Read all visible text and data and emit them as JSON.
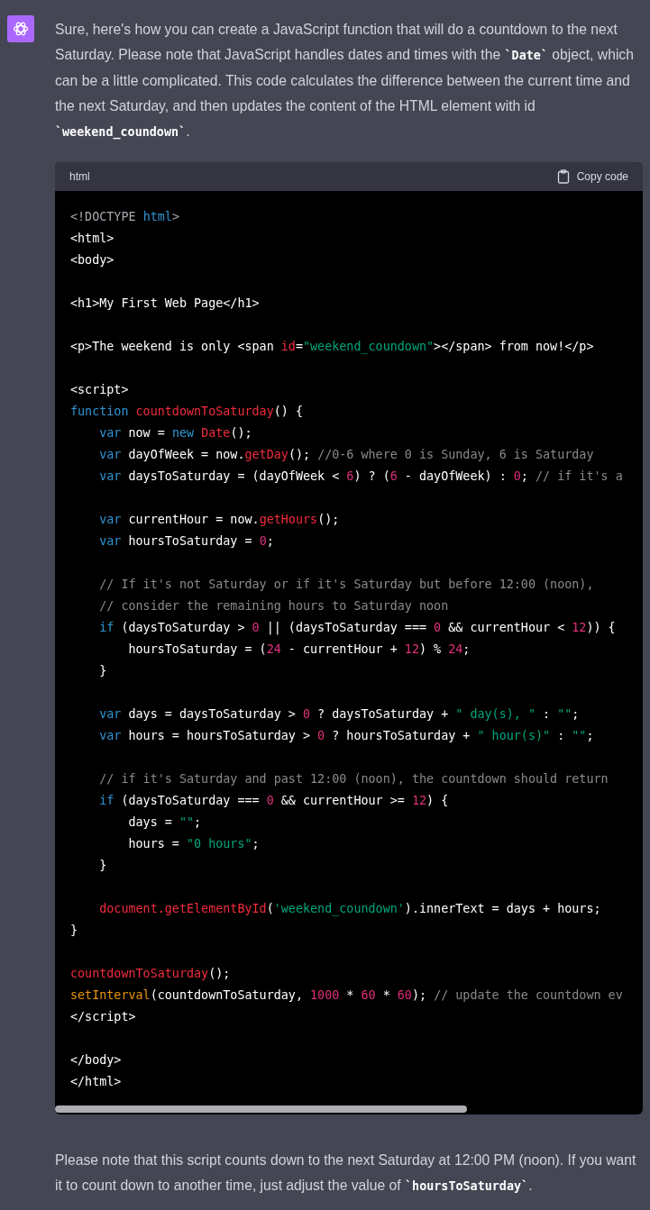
{
  "message": {
    "intro": "Sure, here's how you can create a JavaScript function that will do a countdown to the next Saturday. Please note that JavaScript handles dates and times with the **`Date`** object, which can be a little complicated. This code calculates the difference between the current time and the next Saturday, and then updates the content of the HTML element with id **`weekend_coundown`**.",
    "code_block": {
      "language": "html",
      "copy_label": "Copy code",
      "lines": [
        {
          "kind": "code",
          "tokens": [
            {
              "kind": "meta",
              "text": "<!DOCTYPE "
            },
            {
              "kind": "keyword",
              "text": "html"
            },
            {
              "kind": "meta",
              "text": ">"
            }
          ]
        },
        {
          "kind": "code",
          "tokens": [
            {
              "kind": "plain",
              "text": "<html>"
            }
          ]
        },
        {
          "kind": "code",
          "tokens": [
            {
              "kind": "plain",
              "text": "<body>"
            }
          ]
        },
        {
          "kind": "blank"
        },
        {
          "kind": "code",
          "tokens": [
            {
              "kind": "plain",
              "text": "<h1>My First Web Page</h1>"
            }
          ]
        },
        {
          "kind": "blank"
        },
        {
          "kind": "code",
          "tokens": [
            {
              "kind": "plain",
              "text": "<p>The weekend is only <span "
            },
            {
              "kind": "attr",
              "text": "id"
            },
            {
              "kind": "plain",
              "text": "="
            },
            {
              "kind": "string",
              "text": "\"weekend_coundown\""
            },
            {
              "kind": "plain",
              "text": "></span> from now!</p>"
            }
          ]
        },
        {
          "kind": "blank"
        },
        {
          "kind": "code",
          "tokens": [
            {
              "kind": "plain",
              "text": "<script>"
            }
          ]
        },
        {
          "kind": "code",
          "tokens": [
            {
              "kind": "keyword",
              "text": "function "
            },
            {
              "kind": "title",
              "text": "countdownToSaturday"
            },
            {
              "kind": "plain",
              "text": "() {"
            }
          ]
        },
        {
          "kind": "code",
          "tokens": [
            {
              "kind": "keyword",
              "text": "    var"
            },
            {
              "kind": "plain",
              "text": " now = "
            },
            {
              "kind": "keyword",
              "text": "new "
            },
            {
              "kind": "title",
              "text": "Date"
            },
            {
              "kind": "plain",
              "text": "();"
            }
          ]
        },
        {
          "kind": "code",
          "tokens": [
            {
              "kind": "keyword",
              "text": "    var"
            },
            {
              "kind": "plain",
              "text": " dayOfWeek = now."
            },
            {
              "kind": "title",
              "text": "getDay"
            },
            {
              "kind": "plain",
              "text": "(); "
            },
            {
              "kind": "comment",
              "text": "//0-6 where 0 is Sunday, 6 is Saturday"
            }
          ]
        },
        {
          "kind": "code",
          "tokens": [
            {
              "kind": "keyword",
              "text": "    var"
            },
            {
              "kind": "plain",
              "text": " daysToSaturday = (dayOfWeek < "
            },
            {
              "kind": "number",
              "text": "6"
            },
            {
              "kind": "plain",
              "text": ") ? ("
            },
            {
              "kind": "number",
              "text": "6"
            },
            {
              "kind": "plain",
              "text": " - dayOfWeek) : "
            },
            {
              "kind": "number",
              "text": "0"
            },
            {
              "kind": "plain",
              "text": "; "
            },
            {
              "kind": "comment",
              "text": "// if it's a"
            }
          ]
        },
        {
          "kind": "blank"
        },
        {
          "kind": "code",
          "tokens": [
            {
              "kind": "keyword",
              "text": "    var"
            },
            {
              "kind": "plain",
              "text": " currentHour = now."
            },
            {
              "kind": "title",
              "text": "getHours"
            },
            {
              "kind": "plain",
              "text": "();"
            }
          ]
        },
        {
          "kind": "code",
          "tokens": [
            {
              "kind": "keyword",
              "text": "    var"
            },
            {
              "kind": "plain",
              "text": " hoursToSaturday = "
            },
            {
              "kind": "number",
              "text": "0"
            },
            {
              "kind": "plain",
              "text": ";"
            }
          ]
        },
        {
          "kind": "blank"
        },
        {
          "kind": "code",
          "tokens": [
            {
              "kind": "comment",
              "text": "    // If it's not Saturday or if it's Saturday but before 12:00 (noon),"
            }
          ]
        },
        {
          "kind": "code",
          "tokens": [
            {
              "kind": "comment",
              "text": "    // consider the remaining hours to Saturday noon"
            }
          ]
        },
        {
          "kind": "code",
          "tokens": [
            {
              "kind": "keyword",
              "text": "    if"
            },
            {
              "kind": "plain",
              "text": " (daysToSaturday > "
            },
            {
              "kind": "number",
              "text": "0"
            },
            {
              "kind": "plain",
              "text": " || (daysToSaturday === "
            },
            {
              "kind": "number",
              "text": "0"
            },
            {
              "kind": "plain",
              "text": " && currentHour < "
            },
            {
              "kind": "number",
              "text": "12"
            },
            {
              "kind": "plain",
              "text": ")) {"
            }
          ]
        },
        {
          "kind": "code",
          "tokens": [
            {
              "kind": "plain",
              "text": "        hoursToSaturday = ("
            },
            {
              "kind": "number",
              "text": "24"
            },
            {
              "kind": "plain",
              "text": " - currentHour + "
            },
            {
              "kind": "number",
              "text": "12"
            },
            {
              "kind": "plain",
              "text": ") % "
            },
            {
              "kind": "number",
              "text": "24"
            },
            {
              "kind": "plain",
              "text": ";"
            }
          ]
        },
        {
          "kind": "code",
          "tokens": [
            {
              "kind": "plain",
              "text": "    }"
            }
          ]
        },
        {
          "kind": "blank"
        },
        {
          "kind": "code",
          "tokens": [
            {
              "kind": "keyword",
              "text": "    var"
            },
            {
              "kind": "plain",
              "text": " days = daysToSaturday > "
            },
            {
              "kind": "number",
              "text": "0"
            },
            {
              "kind": "plain",
              "text": " ? daysToSaturday + "
            },
            {
              "kind": "string",
              "text": "\" day(s), \""
            },
            {
              "kind": "plain",
              "text": " : "
            },
            {
              "kind": "string",
              "text": "\"\""
            },
            {
              "kind": "plain",
              "text": ";"
            }
          ]
        },
        {
          "kind": "code",
          "tokens": [
            {
              "kind": "keyword",
              "text": "    var"
            },
            {
              "kind": "plain",
              "text": " hours = hoursToSaturday > "
            },
            {
              "kind": "number",
              "text": "0"
            },
            {
              "kind": "plain",
              "text": " ? hoursToSaturday + "
            },
            {
              "kind": "string",
              "text": "\" hour(s)\""
            },
            {
              "kind": "plain",
              "text": " : "
            },
            {
              "kind": "string",
              "text": "\"\""
            },
            {
              "kind": "plain",
              "text": ";"
            }
          ]
        },
        {
          "kind": "blank"
        },
        {
          "kind": "code",
          "tokens": [
            {
              "kind": "comment",
              "text": "    // if it's Saturday and past 12:00 (noon), the countdown should return"
            }
          ]
        },
        {
          "kind": "code",
          "tokens": [
            {
              "kind": "keyword",
              "text": "    if"
            },
            {
              "kind": "plain",
              "text": " (daysToSaturday === "
            },
            {
              "kind": "number",
              "text": "0"
            },
            {
              "kind": "plain",
              "text": " && currentHour >= "
            },
            {
              "kind": "number",
              "text": "12"
            },
            {
              "kind": "plain",
              "text": ") {"
            }
          ]
        },
        {
          "kind": "code",
          "tokens": [
            {
              "kind": "plain",
              "text": "        days = "
            },
            {
              "kind": "string",
              "text": "\"\""
            },
            {
              "kind": "plain",
              "text": ";"
            }
          ]
        },
        {
          "kind": "code",
          "tokens": [
            {
              "kind": "plain",
              "text": "        hours = "
            },
            {
              "kind": "string",
              "text": "\"0 hours\""
            },
            {
              "kind": "plain",
              "text": ";"
            }
          ]
        },
        {
          "kind": "code",
          "tokens": [
            {
              "kind": "plain",
              "text": "    }"
            }
          ]
        },
        {
          "kind": "blank"
        },
        {
          "kind": "code",
          "tokens": [
            {
              "kind": "title",
              "text": "    document.getElementById"
            },
            {
              "kind": "plain",
              "text": "("
            },
            {
              "kind": "string",
              "text": "'weekend_coundown'"
            },
            {
              "kind": "plain",
              "text": ").innerText = days + hours;"
            }
          ]
        },
        {
          "kind": "code",
          "tokens": [
            {
              "kind": "plain",
              "text": "}"
            }
          ]
        },
        {
          "kind": "blank"
        },
        {
          "kind": "code",
          "tokens": [
            {
              "kind": "title",
              "text": "countdownToSaturday"
            },
            {
              "kind": "plain",
              "text": "();"
            }
          ]
        },
        {
          "kind": "code",
          "tokens": [
            {
              "kind": "builtin",
              "text": "setInterval"
            },
            {
              "kind": "plain",
              "text": "(countdownToSaturday, "
            },
            {
              "kind": "number",
              "text": "1000"
            },
            {
              "kind": "plain",
              "text": " * "
            },
            {
              "kind": "number",
              "text": "60"
            },
            {
              "kind": "plain",
              "text": " * "
            },
            {
              "kind": "number",
              "text": "60"
            },
            {
              "kind": "plain",
              "text": "); "
            },
            {
              "kind": "comment",
              "text": "// update the countdown ev"
            }
          ]
        },
        {
          "kind": "code",
          "tokens": [
            {
              "kind": "plain",
              "text": "</script>"
            }
          ]
        },
        {
          "kind": "blank"
        },
        {
          "kind": "code",
          "tokens": [
            {
              "kind": "plain",
              "text": "</body>"
            }
          ]
        },
        {
          "kind": "code",
          "tokens": [
            {
              "kind": "plain",
              "text": "</html>"
            }
          ]
        }
      ]
    },
    "outro": "Please note that this script counts down to the next Saturday at 12:00 PM (noon). If you want it to count down to another time, just adjust the value of **`hoursToSaturday`**."
  }
}
